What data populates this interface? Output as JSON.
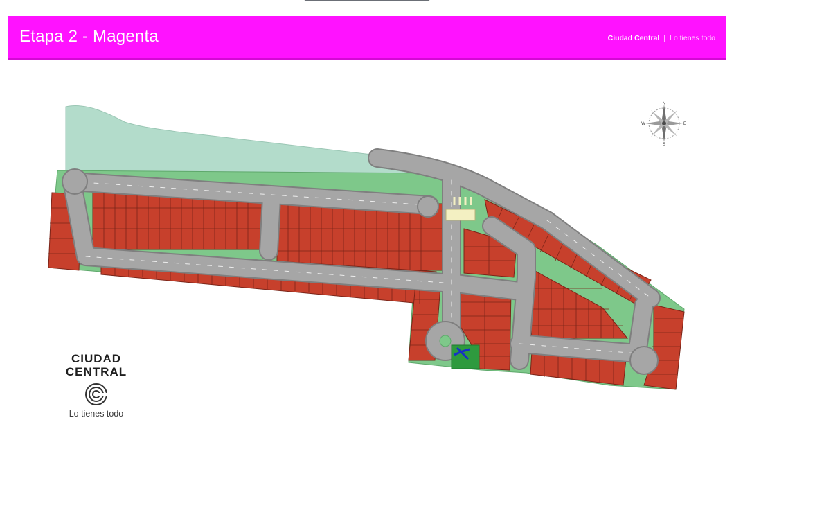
{
  "header": {
    "title": "Etapa 2 - Magenta",
    "brand": "Ciudad Central",
    "separator": "|",
    "tagline": "Lo tienes todo",
    "background_color": "#ff12ff"
  },
  "compass": {
    "north": "N",
    "south": "S",
    "east": "E",
    "west": "W"
  },
  "logo": {
    "line1": "CIUDAD",
    "line2": "CENTRAL",
    "tagline": "Lo tienes todo",
    "icon": "ciudad-central-logo-icon"
  },
  "map": {
    "colors": {
      "lot": "#c7402c",
      "lot_border": "#7a2418",
      "road": "#a6a6a6",
      "road_edge": "#7f7f7f",
      "green_area": "#7ec88a",
      "reserve_area": "#b3dccb",
      "gatehouse": "#f3f0c2",
      "playground_symbol": "#1630c8"
    },
    "features": [
      "lots",
      "roads",
      "green-areas",
      "reserve-area",
      "roundabout",
      "gatehouse",
      "playground"
    ]
  }
}
